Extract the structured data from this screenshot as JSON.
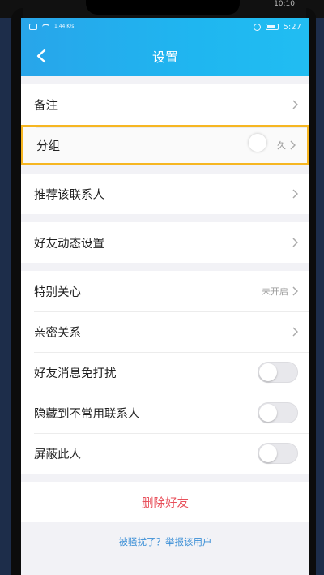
{
  "device": {
    "top_clock": "10:10"
  },
  "status_bar": {
    "net_speed": "1.44 K/s",
    "time": "5:27"
  },
  "header": {
    "title": "设置"
  },
  "groups": [
    [
      {
        "label": "备注",
        "value": "",
        "type": "chevron"
      },
      {
        "label": "分组",
        "value": "久",
        "type": "chevron",
        "highlighted": true
      }
    ],
    [
      {
        "label": "推荐该联系人",
        "value": "",
        "type": "chevron"
      }
    ],
    [
      {
        "label": "好友动态设置",
        "value": "",
        "type": "chevron"
      }
    ],
    [
      {
        "label": "特别关心",
        "value": "未开启",
        "type": "chevron"
      },
      {
        "label": "亲密关系",
        "value": "",
        "type": "chevron"
      },
      {
        "label": "好友消息免打扰",
        "type": "toggle",
        "on": false
      },
      {
        "label": "隐藏到不常用联系人",
        "type": "toggle",
        "on": false
      },
      {
        "label": "屏蔽此人",
        "type": "toggle",
        "on": false
      }
    ]
  ],
  "actions": {
    "delete_friend": "删除好友",
    "report_link": "被骚扰了？举报该用户"
  },
  "colors": {
    "appbar": "#28a5ea",
    "highlight_border": "#f6b622",
    "danger": "#e8505b",
    "link": "#3b8fd6"
  }
}
